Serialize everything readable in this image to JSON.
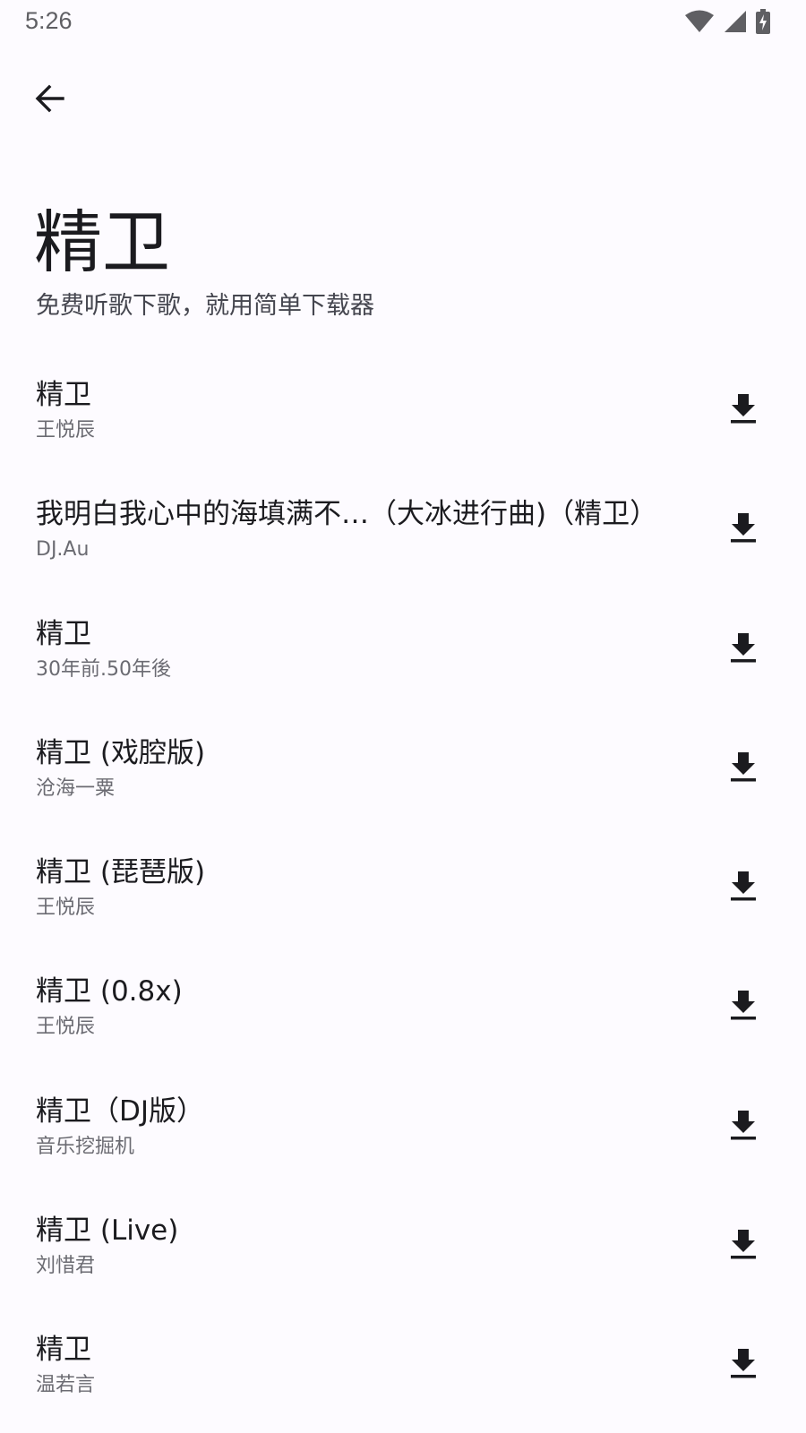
{
  "status_bar": {
    "time": "5:26",
    "icons": [
      "wifi-icon",
      "cellular-signal-icon",
      "battery-charging-icon"
    ]
  },
  "header": {
    "back_icon": "arrow-left-icon",
    "title": "精卫",
    "subtitle": "免费听歌下歌，就用简单下载器"
  },
  "songs": [
    {
      "title": "精卫",
      "artist": "王悦辰"
    },
    {
      "title": "我明白我心中的海填满不…（大冰进行曲)（精卫）",
      "artist": "DJ.Au"
    },
    {
      "title": "精卫",
      "artist": "30年前.50年後"
    },
    {
      "title": "精卫 (戏腔版)",
      "artist": "沧海一粟"
    },
    {
      "title": "精卫 (琵琶版)",
      "artist": "王悦辰"
    },
    {
      "title": "精卫 (0.8x)",
      "artist": "王悦辰"
    },
    {
      "title": "精卫（DJ版）",
      "artist": "音乐挖掘机"
    },
    {
      "title": "精卫 (Live)",
      "artist": "刘惜君"
    },
    {
      "title": "精卫",
      "artist": "温若言"
    }
  ],
  "colors": {
    "background": "#fdfbff",
    "primary_text": "#1b1b1f",
    "secondary_text": "#6b6b72"
  }
}
